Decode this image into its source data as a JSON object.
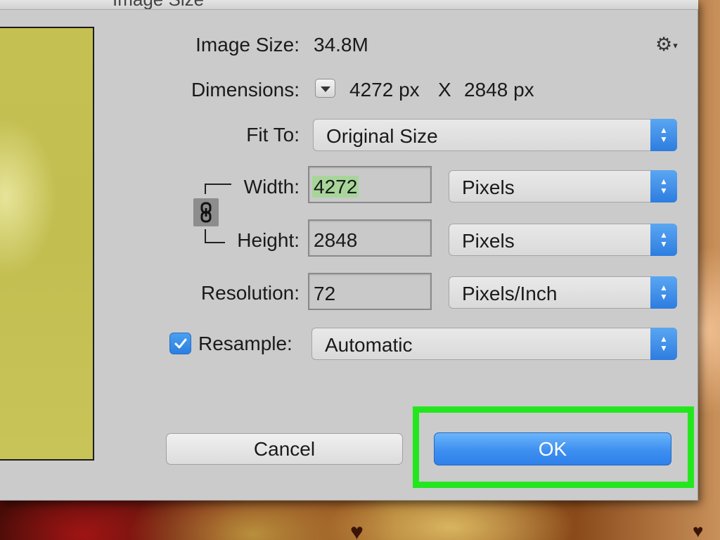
{
  "window": {
    "title": "Image Size"
  },
  "image_size": {
    "label": "Image Size:",
    "value": "34.8M"
  },
  "dimensions": {
    "label": "Dimensions:",
    "width": "4272 px",
    "separator": "X",
    "height": "2848 px"
  },
  "fit_to": {
    "label": "Fit To:",
    "value": "Original Size"
  },
  "width": {
    "label": "Width:",
    "value": "4272",
    "unit": "Pixels"
  },
  "height": {
    "label": "Height:",
    "value": "2848",
    "unit": "Pixels"
  },
  "resolution": {
    "label": "Resolution:",
    "value": "72",
    "unit": "Pixels/Inch"
  },
  "resample": {
    "label": "Resample:",
    "checked": true,
    "value": "Automatic"
  },
  "buttons": {
    "cancel": "Cancel",
    "ok": "OK"
  },
  "icons": {
    "settings": "gear-icon",
    "dimensions_toggle": "disclosure-triangle-icon",
    "constrain": "chain-link-icon",
    "resample_check": "checkmark-icon",
    "popup_arrows": "up-down-chevron-icon"
  },
  "colors": {
    "dialog_bg": "#cbcbcb",
    "accent_blue": "#2f80ea",
    "highlight_green": "#24e61f",
    "text_selection": "#a8d69a",
    "preview_yellow": "#c5c052"
  }
}
